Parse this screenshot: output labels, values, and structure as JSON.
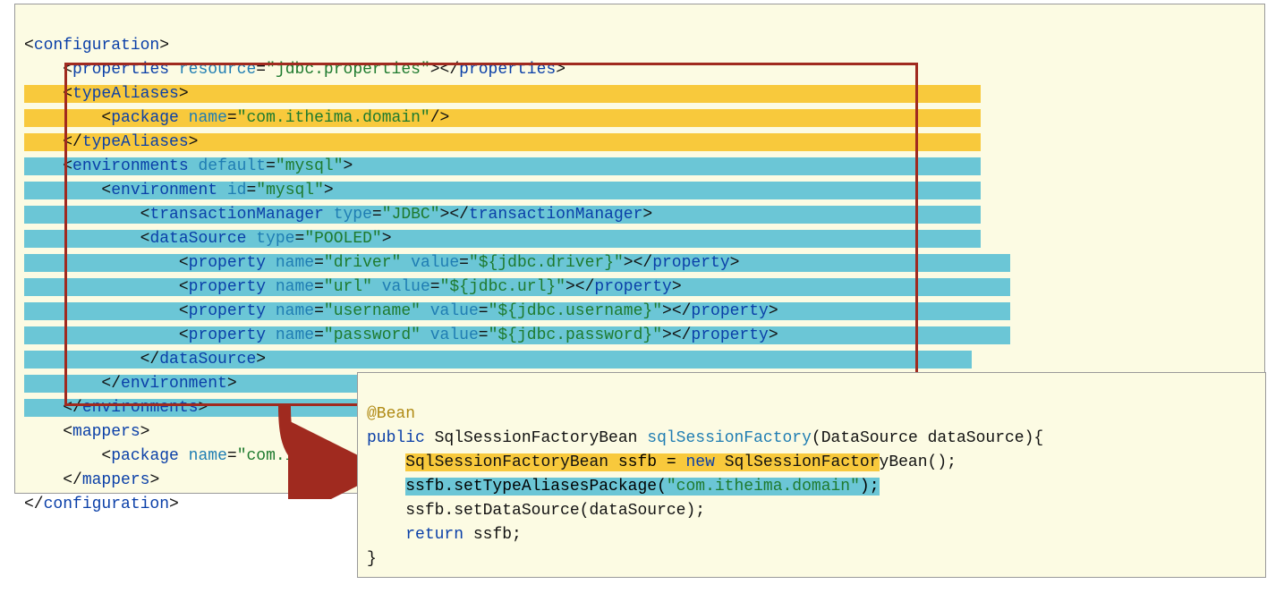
{
  "xml": {
    "configuration_open": "<configuration>",
    "properties_full": "<properties resource=\"jdbc.properties\"></properties>",
    "typeAliases_open": "<typeAliases>",
    "package_alias": "<package name=\"com.itheima.domain\"/>",
    "typeAliases_close": "</typeAliases>",
    "environments_open": "<environments default=\"mysql\">",
    "environment_open": "<environment id=\"mysql\">",
    "txmgr": "<transactionManager type=\"JDBC\"></transactionManager>",
    "ds_open": "<dataSource type=\"POOLED\">",
    "prop_driver": "<property name=\"driver\" value=\"${jdbc.driver}\"></property>",
    "prop_url": "<property name=\"url\" value=\"${jdbc.url}\"></property>",
    "prop_user": "<property name=\"username\" value=\"${jdbc.username}\"></property>",
    "prop_pass": "<property name=\"password\" value=\"${jdbc.password}\"></property>",
    "ds_close": "</dataSource>",
    "environment_close": "</environment>",
    "environments_close": "</environments>",
    "mappers_open": "<mappers>",
    "package_mapper": "<package name=\"com.itheima.dao\"></package>",
    "mappers_close": "</mappers>",
    "configuration_close": "</configuration>"
  },
  "java": {
    "bean": "@Bean",
    "sig": "public SqlSessionFactoryBean sqlSessionFactory(DataSource dataSource){",
    "l1": "SqlSessionFactoryBean ssfb = new SqlSessionFactoryBean();",
    "l2": "ssfb.setTypeAliasesPackage(\"com.itheima.domain\");",
    "l3": "ssfb.setDataSource(dataSource);",
    "l4": "return ssfb;",
    "close": "}"
  }
}
